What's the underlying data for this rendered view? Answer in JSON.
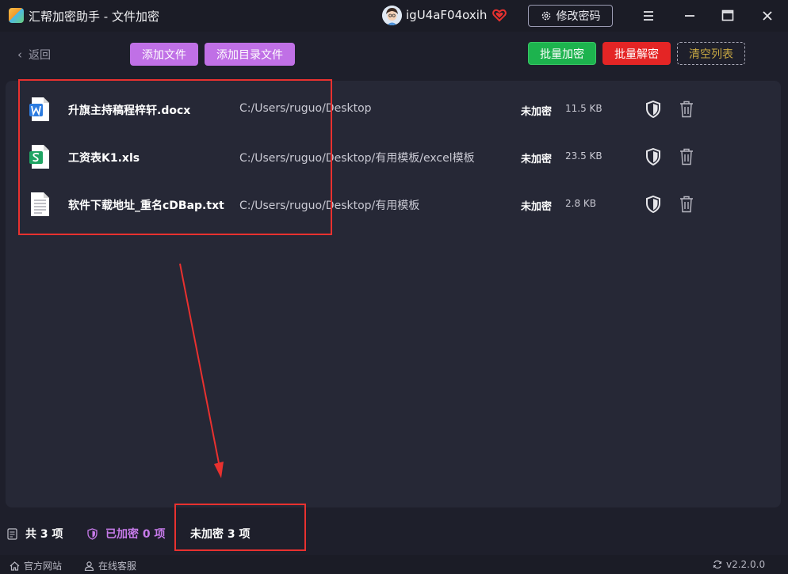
{
  "window": {
    "title": "汇帮加密助手 - 文件加密",
    "username": "igU4aF04oxih",
    "change_password_label": "修改密码"
  },
  "toolbar": {
    "back_label": "返回",
    "add_file_label": "添加文件",
    "add_dir_label": "添加目录文件",
    "batch_encrypt_label": "批量加密",
    "batch_decrypt_label": "批量解密",
    "clear_list_label": "清空列表"
  },
  "files": [
    {
      "name": "升旗主持稿程梓轩.docx",
      "path": "C:/Users/ruguo/Desktop",
      "status": "未加密",
      "size": "11.5 KB",
      "icon": "word-doc-icon"
    },
    {
      "name": "工资表K1.xls",
      "path": "C:/Users/ruguo/Desktop/有用模板/excel模板",
      "status": "未加密",
      "size": "23.5 KB",
      "icon": "excel-sheet-icon"
    },
    {
      "name": "软件下载地址_重名cDBap.txt",
      "path": "C:/Users/ruguo/Desktop/有用模板",
      "status": "未加密",
      "size": "2.8 KB",
      "icon": "text-file-icon"
    }
  ],
  "status": {
    "total_label": "共 3 项",
    "encrypted_label": "已加密 0 项",
    "unencrypted_label": "未加密 3 项"
  },
  "footer": {
    "website_label": "官方网站",
    "support_label": "在线客服",
    "version": "v2.2.0.0"
  },
  "colors": {
    "accent_purple": "#c070e6",
    "encrypt_green": "#1db34e",
    "decrypt_red": "#e42525",
    "clear_gold": "#c8a843",
    "annotation_red": "#e8312f"
  }
}
